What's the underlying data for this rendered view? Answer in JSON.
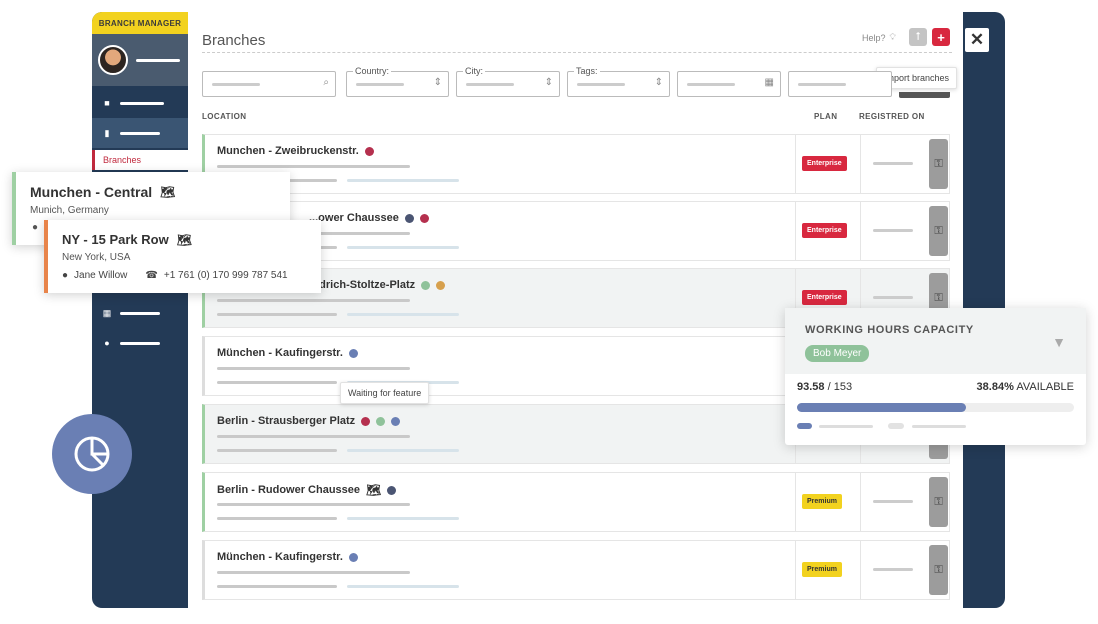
{
  "sidebar": {
    "role": "BRANCH MANAGER",
    "branches_link": "Branches"
  },
  "header": {
    "title": "Branches",
    "help": "Help?",
    "import_tooltip": "Import branches",
    "add_icon": "plus-icon",
    "import_icon": "upload-icon",
    "close_icon": "close-icon"
  },
  "filters": {
    "country_label": "Country:",
    "city_label": "City:",
    "tags_label": "Tags:"
  },
  "table": {
    "headers": {
      "location": "LOCATION",
      "plan": "PLAN",
      "registered": "REGISTRED ON"
    },
    "rows": [
      {
        "name": "Munchen - Zweibruckenstr.",
        "plan": "Enterprise"
      },
      {
        "name": "...ower Chaussee",
        "plan": "Enterprise"
      },
      {
        "name": "Friedrich-Stoltze-Platz",
        "plan": "Enterprise"
      },
      {
        "name": "München - Kaufingerstr.",
        "plan": ""
      },
      {
        "name": "Berlin - Strausberger Platz",
        "plan": ""
      },
      {
        "name": "Berlin - Rudower Chaussee",
        "plan": "Premium"
      },
      {
        "name": "München - Kaufingerstr.",
        "plan": "Premium"
      }
    ],
    "hover_tooltip": "Waiting for feature"
  },
  "cards": {
    "munich": {
      "name": "Munchen - Central",
      "location": "Munich, Germany"
    },
    "ny": {
      "name": "NY - 15 Park Row",
      "location": "New York, USA",
      "contact": "Jane Willow",
      "phone": "+1 761 (0) 170 999 787 541"
    }
  },
  "capacity": {
    "title": "WORKING HOURS CAPACITY",
    "person": "Bob Meyer",
    "used": "93.58",
    "total": "/ 153",
    "available_pct": "38.84%",
    "available_label": "AVAILABLE",
    "fill_fraction": 0.6116
  },
  "colors": {
    "enterprise": "#d8283f",
    "premium": "#f2d21f",
    "dot_red": "#b5304e",
    "dot_navy": "#4b5573",
    "dot_blue": "#6a7fb4",
    "dot_green": "#8fc29a",
    "dot_orange": "#d7a04d"
  }
}
